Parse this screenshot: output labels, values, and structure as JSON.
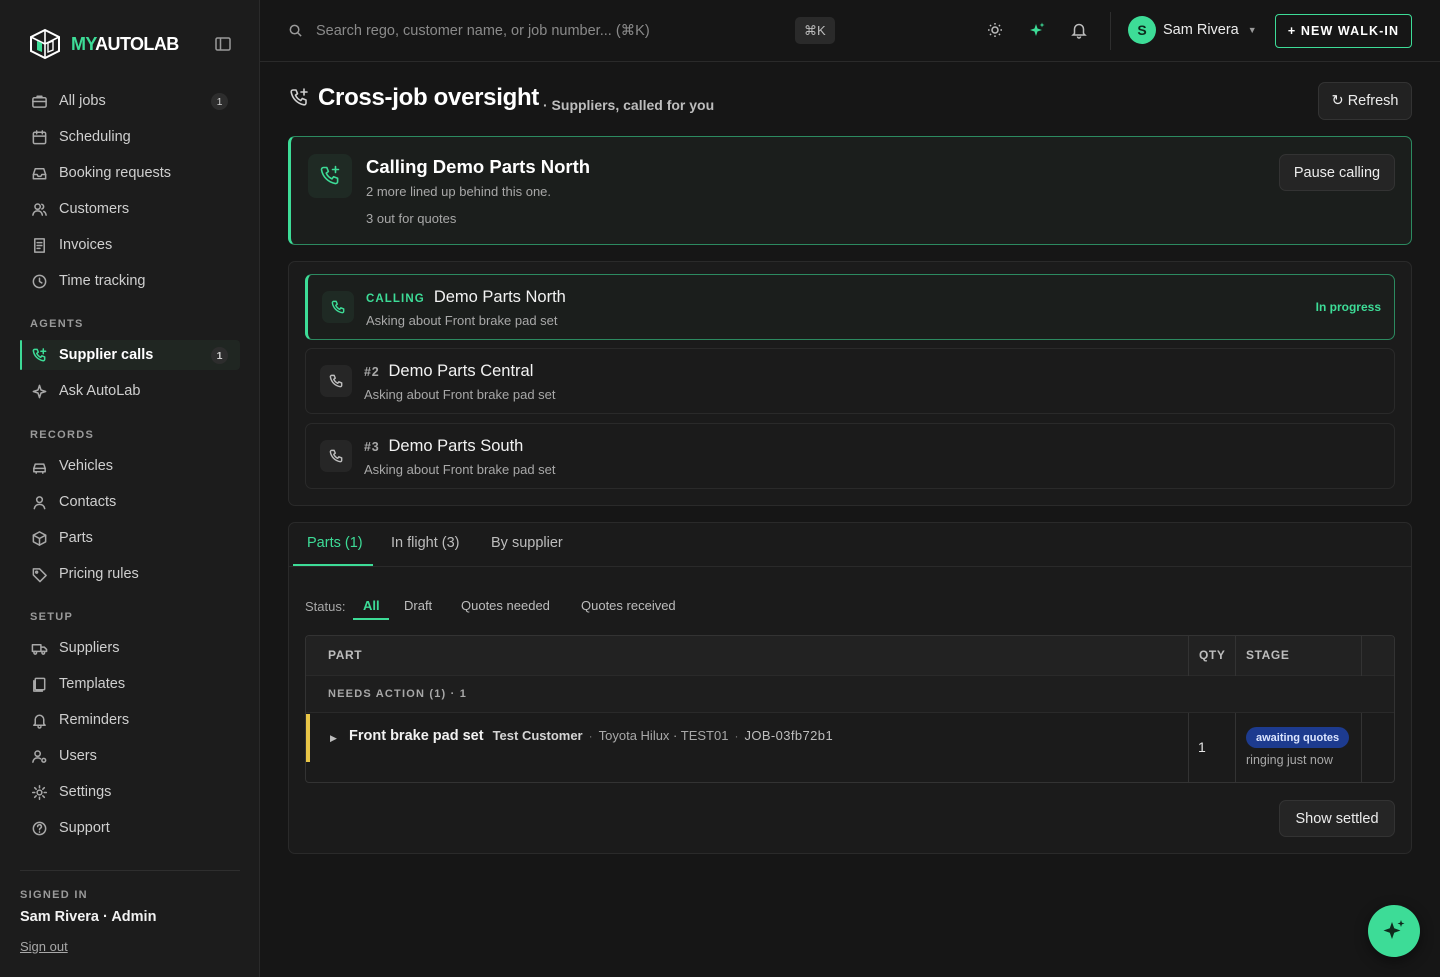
{
  "brand": {
    "my": "MY",
    "rest": "AUTOLAB"
  },
  "sidebar": {
    "main_items": [
      {
        "label": "All jobs",
        "badge": "1",
        "icon": "briefcase-icon"
      },
      {
        "label": "Scheduling",
        "icon": "calendar-icon"
      },
      {
        "label": "Booking requests",
        "icon": "inbox-icon"
      },
      {
        "label": "Customers",
        "icon": "users-icon"
      },
      {
        "label": "Invoices",
        "icon": "invoice-icon"
      },
      {
        "label": "Time tracking",
        "icon": "clock-icon"
      }
    ],
    "sections": {
      "agents": "AGENTS",
      "records": "RECORDS",
      "setup": "SETUP"
    },
    "agent_items": [
      {
        "label": "Supplier calls",
        "badge": "1",
        "active": true,
        "icon": "phone-plus-icon"
      },
      {
        "label": "Ask AutoLab",
        "icon": "sparkle-icon"
      }
    ],
    "record_items": [
      {
        "label": "Vehicles",
        "icon": "car-icon"
      },
      {
        "label": "Contacts",
        "icon": "user-icon"
      },
      {
        "label": "Parts",
        "icon": "box-icon"
      },
      {
        "label": "Pricing rules",
        "icon": "tag-icon"
      }
    ],
    "setup_items": [
      {
        "label": "Suppliers",
        "icon": "truck-icon"
      },
      {
        "label": "Templates",
        "icon": "template-icon"
      },
      {
        "label": "Reminders",
        "icon": "bell-icon"
      },
      {
        "label": "Users",
        "icon": "users-cog-icon"
      },
      {
        "label": "Settings",
        "icon": "gear-icon"
      },
      {
        "label": "Support",
        "icon": "help-circle-icon"
      }
    ],
    "signed_in_label": "SIGNED IN",
    "signed_in_user": "Sam Rivera · Admin",
    "sign_out": "Sign out"
  },
  "header": {
    "search_placeholder": "Search rego, customer name, or job number... (⌘K)",
    "shortcut": "⌘K",
    "user_initial": "S",
    "user_name": "Sam Rivera",
    "new_walkin": "+ NEW WALK-IN"
  },
  "page": {
    "title": "Cross-job oversight",
    "subtitle": "· Suppliers, called for you",
    "refresh": "↻ Refresh"
  },
  "current_call": {
    "title": "Calling Demo Parts North",
    "line1": "2 more lined up behind this one.",
    "line2": "3 out for quotes",
    "pause": "Pause calling"
  },
  "queue": [
    {
      "tag": "CALLING",
      "name": "Demo Parts North",
      "sub": "Asking about Front brake pad set",
      "status": "In progress",
      "current": true
    },
    {
      "tag": "#2",
      "name": "Demo Parts Central",
      "sub": "Asking about Front brake pad set"
    },
    {
      "tag": "#3",
      "name": "Demo Parts South",
      "sub": "Asking about Front brake pad set"
    }
  ],
  "tabs": [
    {
      "label": "Parts (1)",
      "active": true
    },
    {
      "label": "In flight (3)"
    },
    {
      "label": "By supplier"
    }
  ],
  "filters": {
    "label": "Status:",
    "options": [
      "All",
      "Draft",
      "Quotes needed",
      "Quotes received"
    ],
    "active": "All"
  },
  "table": {
    "columns": [
      "PART",
      "QTY",
      "STAGE"
    ],
    "group": "NEEDS ACTION (1) · 1",
    "rows": [
      {
        "part": "Front brake pad set",
        "customer": "Test Customer",
        "vehicle": "Toyota Hilux · TEST01",
        "job": "JOB-03fb72b1",
        "qty": "1",
        "stage": "awaiting quotes",
        "stage_sub": "ringing just now"
      }
    ]
  },
  "show_settled": "Show settled",
  "colors": {
    "accent": "#3ddc97",
    "warning": "#e8c547",
    "stage_pill": "#1d3b8f"
  }
}
